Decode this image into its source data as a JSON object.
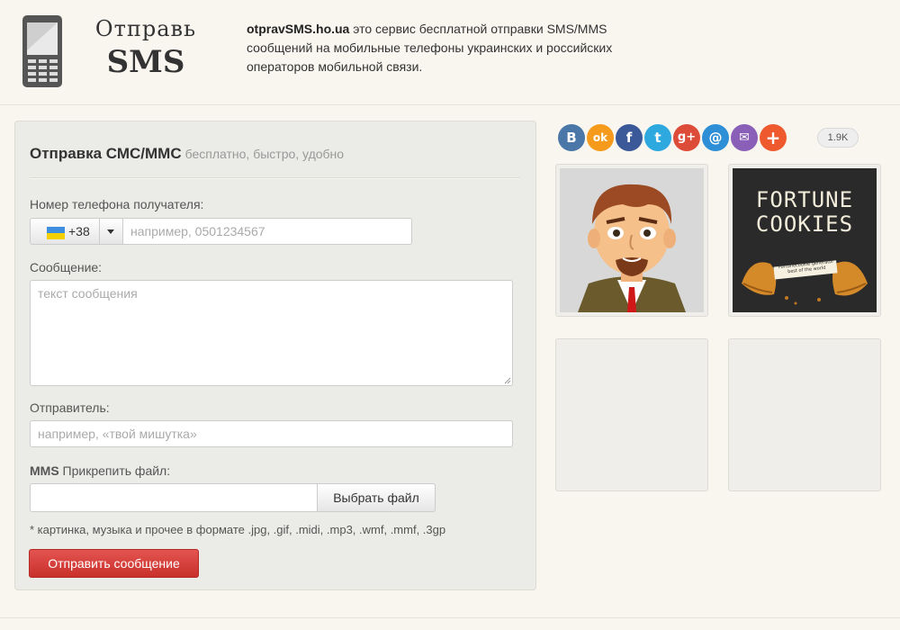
{
  "header": {
    "logo_line1": "Отправь",
    "logo_line2": "SMS",
    "site_name": "otpravSMS.ho.ua",
    "description": " это сервис бесплатной отправки SMS/MMS сообщений на мобильные телефоны украинских и российских операторов мобильной связи."
  },
  "form": {
    "title": "Отправка СМС/ММС",
    "subtitle": "бесплатно, быстро, удобно",
    "phone_label": "Номер телефона получателя:",
    "country_code": "+38",
    "phone_placeholder": "например, 0501234567",
    "message_label": "Сообщение:",
    "message_placeholder": "текст сообщения",
    "sender_label": "Отправитель:",
    "sender_placeholder": "например, «твой мишутка»",
    "attach_label_bold": "MMS",
    "attach_label": " Прикрепить файл:",
    "file_button": "Выбрать файл",
    "file_note": "* картинка, музыка и прочее в формате .jpg, .gif, .midi, .mp3, .wmf, .mmf, .3gp",
    "submit_label": "Отправить сообщение"
  },
  "social": {
    "buttons": [
      {
        "name": "vkontakte-icon",
        "glyph": "B",
        "color": "#4a76a8"
      },
      {
        "name": "odnoklassniki-icon",
        "glyph": "ok",
        "color": "#f59a1b"
      },
      {
        "name": "facebook-icon",
        "glyph": "f",
        "color": "#3b5998"
      },
      {
        "name": "twitter-icon",
        "glyph": "t",
        "color": "#2ea9e0"
      },
      {
        "name": "google-plus-icon",
        "glyph": "g+",
        "color": "#dd4b39"
      },
      {
        "name": "mail-ru-icon",
        "glyph": "@",
        "color": "#2f8fd6"
      },
      {
        "name": "email-icon",
        "glyph": "✉",
        "color": "#8a5fb8"
      },
      {
        "name": "more-share-icon",
        "glyph": "+",
        "color": "#ee5a2e"
      }
    ],
    "count": "1.9K"
  },
  "ads": {
    "fortune_title_line1": "FORTUNE",
    "fortune_title_line2": "COOKIES",
    "fortune_caption_line1": "Fortunecookie generator",
    "fortune_caption_line2": "best of the world"
  }
}
